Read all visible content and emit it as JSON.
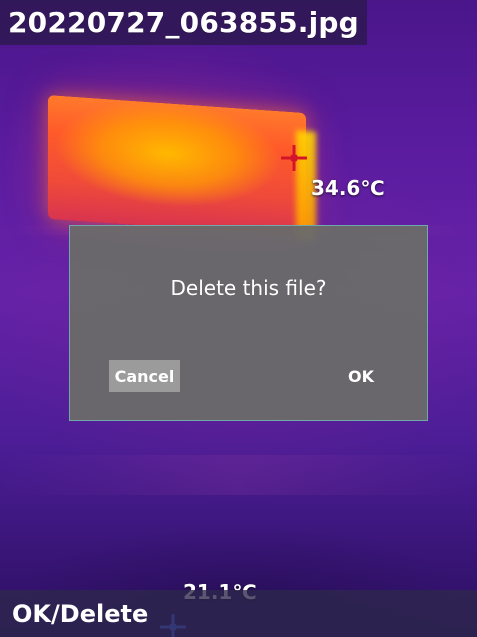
{
  "title": {
    "filename": "20220727_063855.jpg"
  },
  "measurements": {
    "hot": {
      "label": "34.6℃",
      "icon": "crosshair-icon",
      "color": "#d3142a"
    },
    "cold": {
      "label": "21.1℃",
      "icon": "crosshair-icon",
      "color": "#4b6cff"
    }
  },
  "dialog": {
    "message": "Delete this file?",
    "cancel_label": "Cancel",
    "ok_label": "OK"
  },
  "footer": {
    "hint": "OK/Delete"
  },
  "colors": {
    "accent_border": "#70a9a9",
    "dialog_bg": "#6a6a6a",
    "cancel_bg": "#9b9b9b"
  }
}
